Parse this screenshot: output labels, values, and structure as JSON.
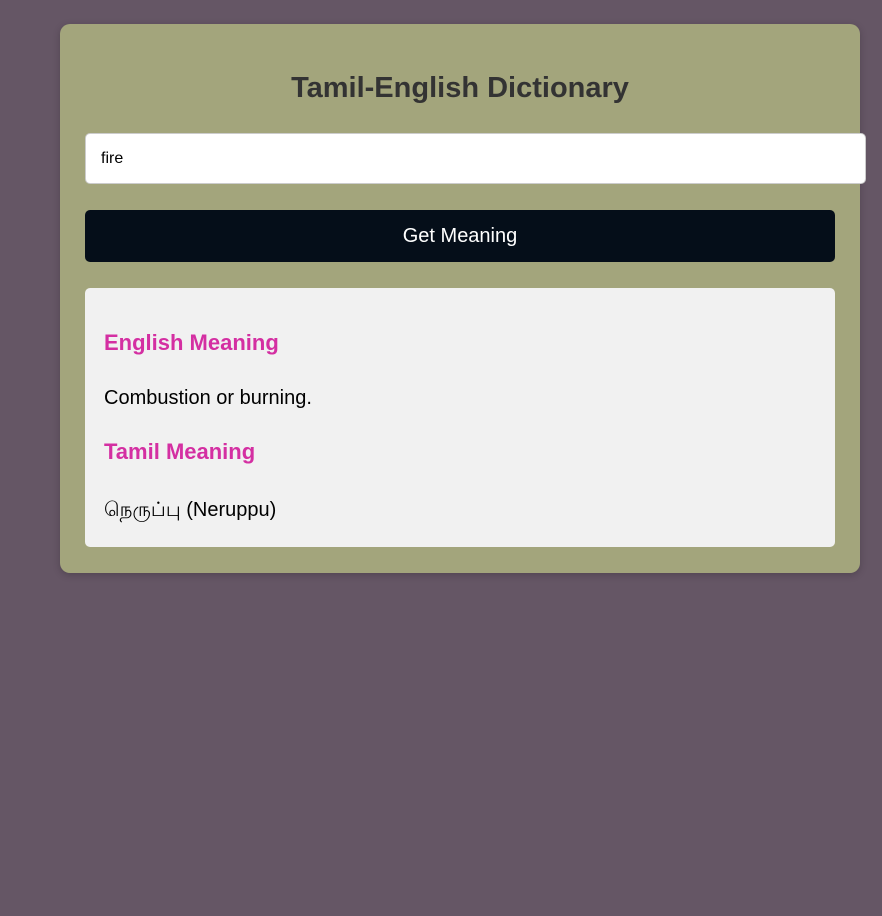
{
  "app": {
    "title": "Tamil-English Dictionary"
  },
  "search": {
    "value": "fire"
  },
  "button": {
    "label": "Get Meaning"
  },
  "result": {
    "english_heading": "English Meaning",
    "english_text": "Combustion or burning.",
    "tamil_heading": "Tamil Meaning",
    "tamil_text": "நெருப்பு (Neruppu)"
  },
  "colors": {
    "background": "#655665",
    "card": "#a3a57c",
    "button": "#050e19",
    "heading": "#d42fa2"
  }
}
